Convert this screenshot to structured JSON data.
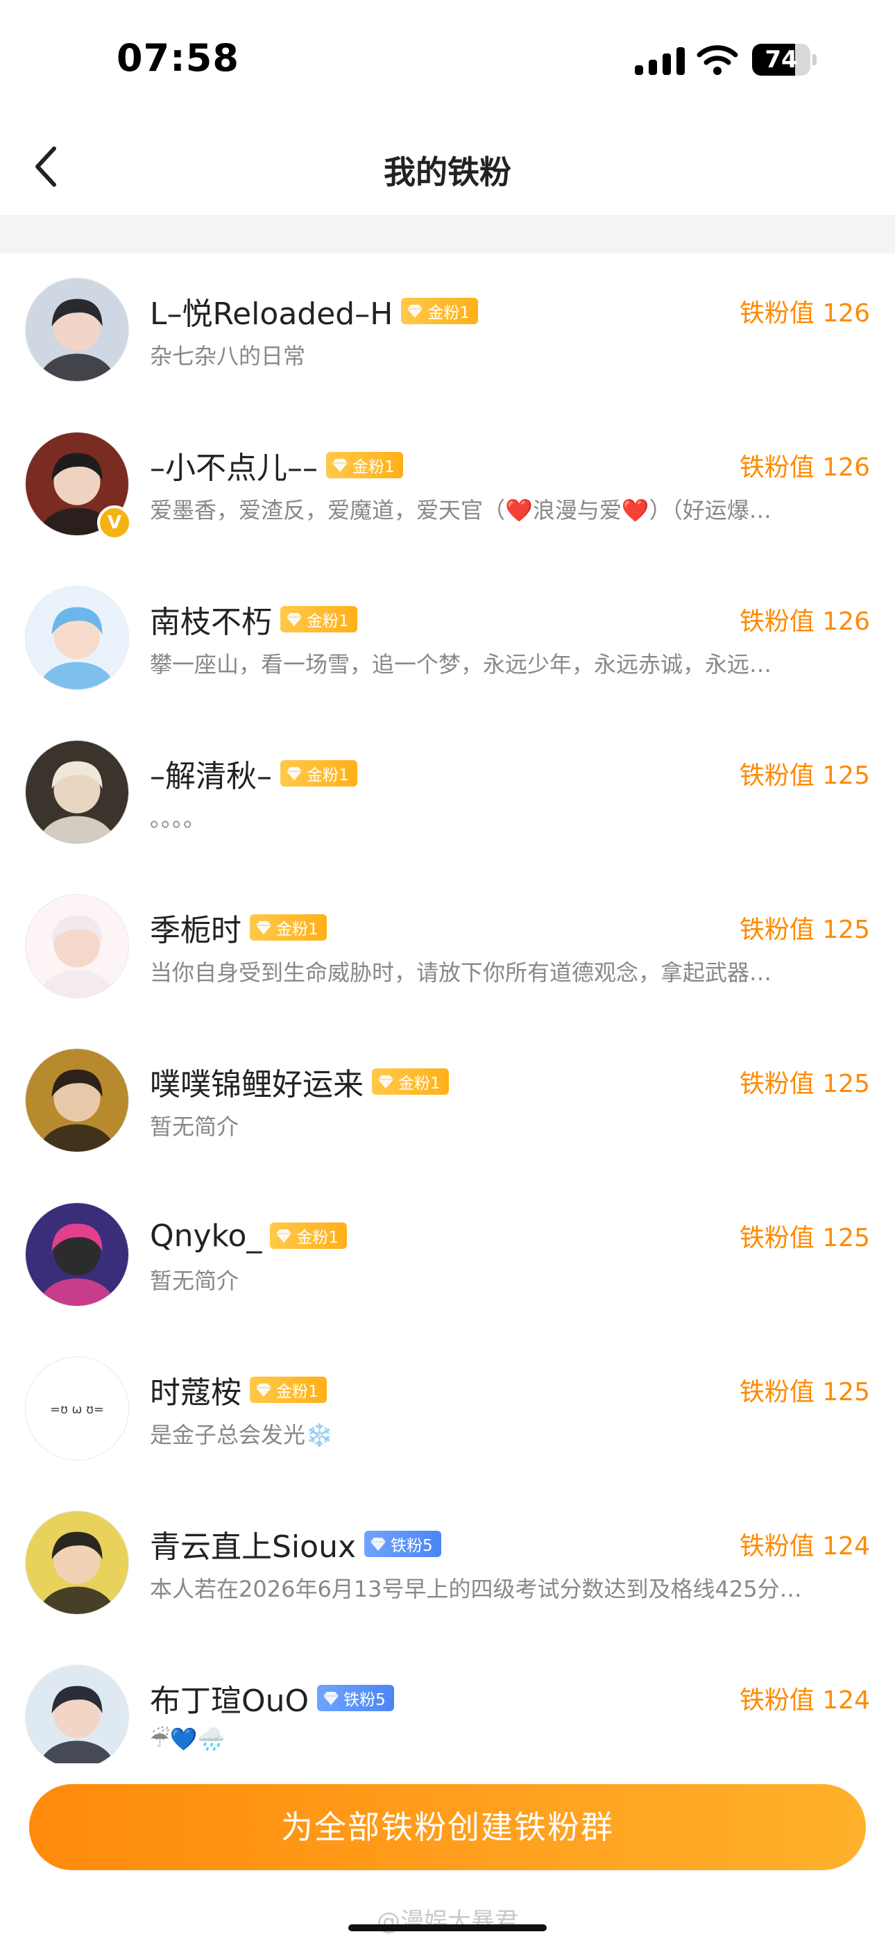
{
  "status_bar": {
    "time": "07:58",
    "battery": "74",
    "battery_level": 0.74
  },
  "header": {
    "title": "我的铁粉"
  },
  "fans": [
    {
      "name": "L–悦Reloaded–H",
      "badge": "金粉1",
      "badge_type": "gold",
      "score": "铁粉值 126",
      "bio": "杂七杂八的日常",
      "verified": false
    },
    {
      "name": "–小不点儿––",
      "badge": "金粉1",
      "badge_type": "gold",
      "score": "铁粉值 126",
      "bio": "爱墨香，爱渣反，爱魔道，爱天官（❤️浪漫与爱❤️）（好运爆…",
      "verified": true
    },
    {
      "name": "南枝不朽",
      "badge": "金粉1",
      "badge_type": "gold",
      "score": "铁粉值 126",
      "bio": "攀一座山，看一场雪，追一个梦，永远少年，永远赤诚，永远…",
      "verified": false
    },
    {
      "name": "–解清秋–",
      "badge": "金粉1",
      "badge_type": "gold",
      "score": "铁粉值 125",
      "bio": "。。。。",
      "verified": false
    },
    {
      "name": "季栀时",
      "badge": "金粉1",
      "badge_type": "gold",
      "score": "铁粉值 125",
      "bio": "当你自身受到生命威胁时，请放下你所有道德观念，拿起武器…",
      "verified": false
    },
    {
      "name": "噗噗锦鲤好运来",
      "badge": "金粉1",
      "badge_type": "gold",
      "score": "铁粉值 125",
      "bio": "暂无简介",
      "verified": false
    },
    {
      "name": "Qnyko_",
      "badge": "金粉1",
      "badge_type": "gold",
      "score": "铁粉值 125",
      "bio": "暂无简介",
      "verified": false
    },
    {
      "name": "时蔻桉",
      "badge": "金粉1",
      "badge_type": "gold",
      "score": "铁粉值 125",
      "bio": "是金子总会发光❄️",
      "verified": false
    },
    {
      "name": "青云直上Sioux",
      "badge": "铁粉5",
      "badge_type": "iron",
      "score": "铁粉值 124",
      "bio": "本人若在2026年6月13号早上的四级考试分数达到及格线425分…",
      "verified": false
    },
    {
      "name": "布丁瑄OuO",
      "badge": "铁粉5",
      "badge_type": "iron",
      "score": "铁粉值 124",
      "bio": "☔💙🌧️",
      "verified": false
    }
  ],
  "footer": {
    "create_button": "为全部铁粉创建铁粉群",
    "watermark": "@漫娱大暴君"
  },
  "colors": {
    "accent": "#ff8a00",
    "gold_badge": "#ffb018",
    "iron_badge": "#4c86f5"
  },
  "icons": {
    "back": "chevron-left-icon",
    "gem": "diamond-gem-icon",
    "verified": "verified-v-icon"
  }
}
